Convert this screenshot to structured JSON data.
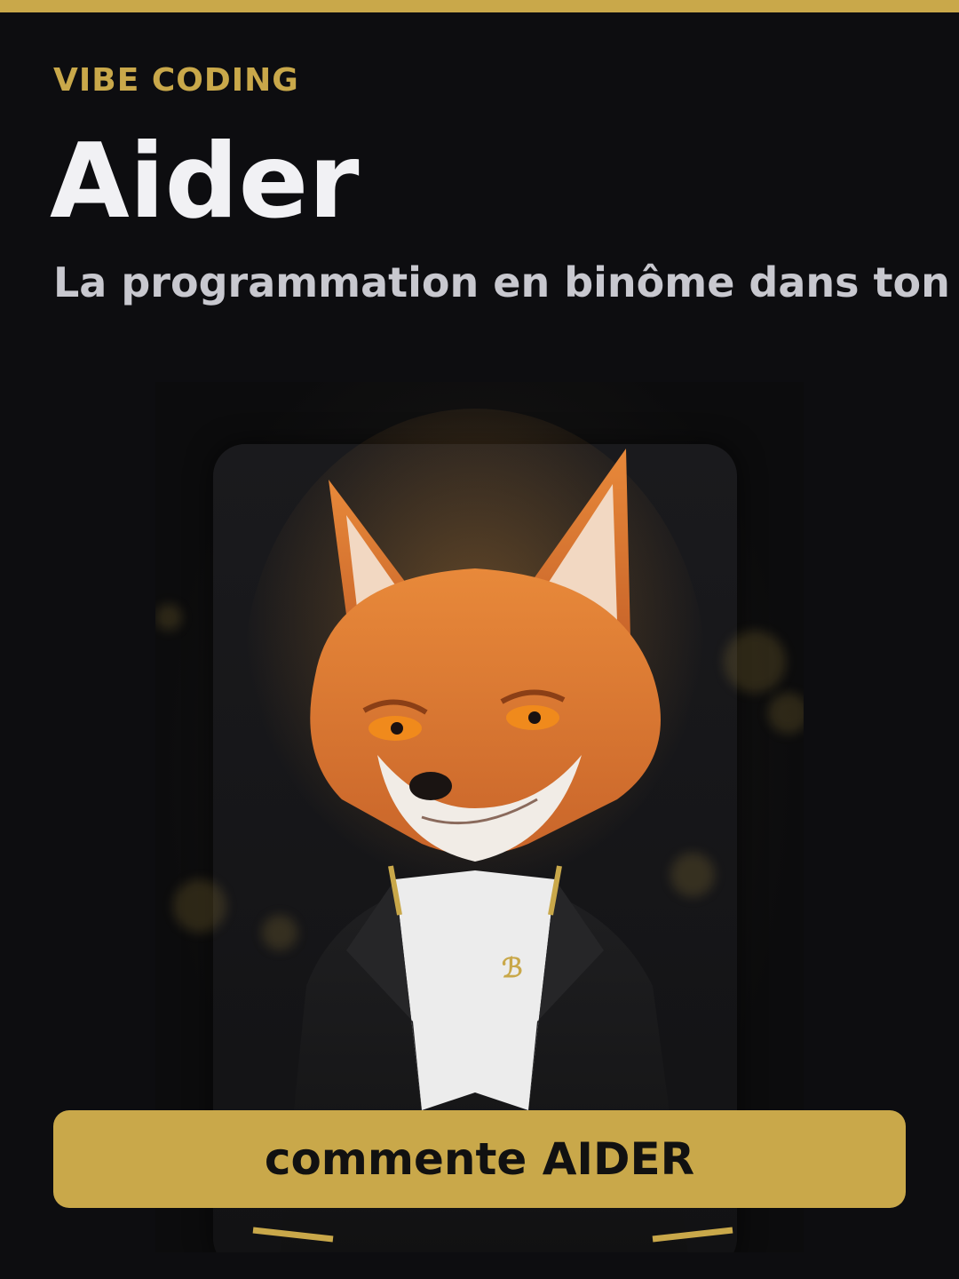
{
  "accent_color": "#c9a84a",
  "background_color": "#0d0d10",
  "header": {
    "eyebrow": "VIBE CODING",
    "title": "Aider",
    "subtitle": "La programmation en binôme dans ton"
  },
  "hero": {
    "image": "fox-mascot-in-black-suit",
    "pin_glyph": "ℬ"
  },
  "cta": {
    "label": "commente AIDER"
  }
}
